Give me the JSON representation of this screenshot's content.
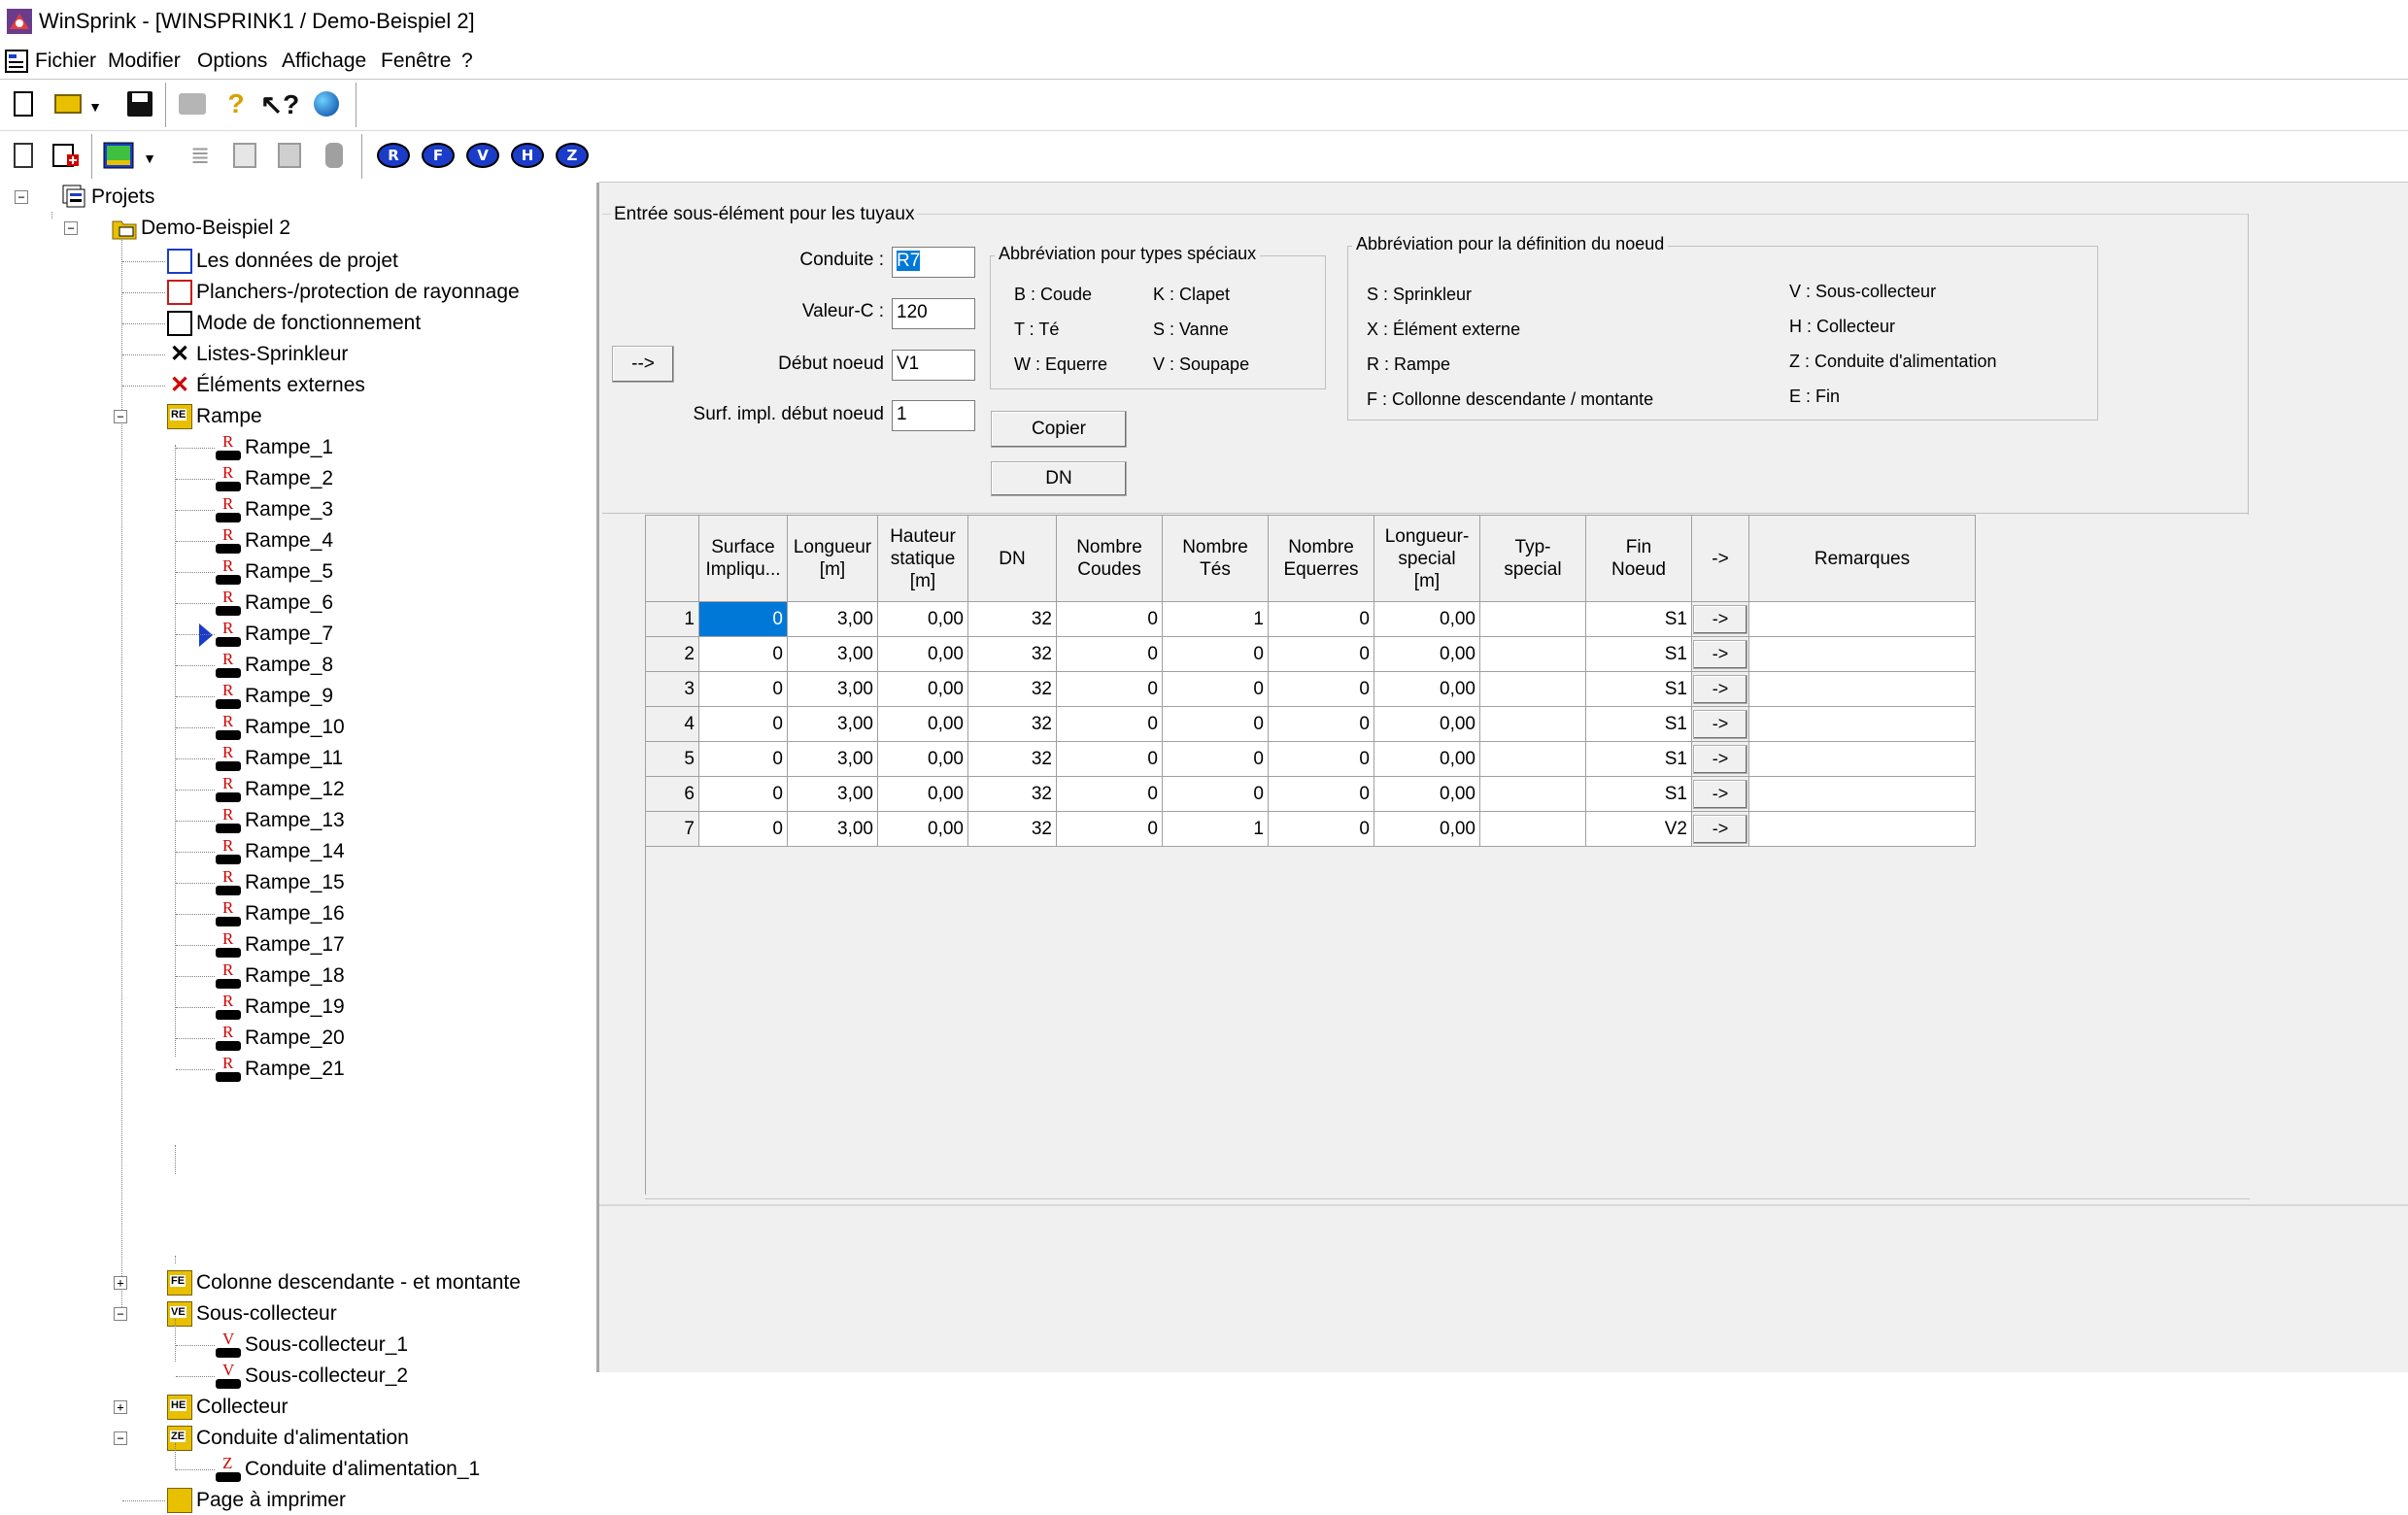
{
  "window": {
    "title": "WinSprink - [WINSPRINK1 / Demo-Beispiel 2]",
    "app_icon": "winsprink-app-icon"
  },
  "menu": {
    "items": [
      "Fichier",
      "Modifier",
      "Options",
      "Affichage",
      "Fenêtre",
      "?"
    ]
  },
  "toolbar1": {
    "icons": [
      "new-document-icon",
      "open-folder-icon",
      "dropdown-arrow-icon",
      "save-disk-icon",
      "print-icon",
      "help-icon",
      "context-help-icon",
      "web-globe-icon"
    ]
  },
  "toolbar2": {
    "icons": [
      "project-data-icon",
      "add-element-icon",
      "image-view-icon",
      "dropdown-arrow-icon",
      "list-icon",
      "window-icon",
      "picture-icon",
      "cylinder-icon"
    ],
    "letter_buttons": [
      "R",
      "F",
      "V",
      "H",
      "Z"
    ]
  },
  "tree": {
    "root": "Projets",
    "project": "Demo-Beispiel 2",
    "items": [
      "Les données de projet",
      "Planchers-/protection de rayonnage",
      "Mode de fonctionnement",
      "Listes-Sprinkleur",
      "Éléments externes"
    ],
    "rampe_folder": "Rampe",
    "rampe_items": [
      "Rampe_1",
      "Rampe_2",
      "Rampe_3",
      "Rampe_4",
      "Rampe_5",
      "Rampe_6",
      "Rampe_7",
      "Rampe_8",
      "Rampe_9",
      "Rampe_10",
      "Rampe_11",
      "Rampe_12",
      "Rampe_13",
      "Rampe_14",
      "Rampe_15",
      "Rampe_16",
      "Rampe_17",
      "Rampe_18",
      "Rampe_19",
      "Rampe_20",
      "Rampe_21"
    ],
    "rampe_letter": "R",
    "colonne_folder": "Colonne descendante - et montante",
    "sous_collecteur_folder": "Sous-collecteur",
    "sous_collecteur_items": [
      "Sous-collecteur_1",
      "Sous-collecteur_2"
    ],
    "sous_collecteur_letter": "V",
    "collecteur_folder": "Collecteur",
    "conduite_folder": "Conduite d'alimentation",
    "conduite_items": [
      "Conduite d'alimentation_1"
    ],
    "conduite_letter": "Z",
    "page_item": "Page à imprimer",
    "folder_tags": {
      "rampe": "RE",
      "colonne": "FE",
      "sous": "VE",
      "collecteur": "HE",
      "conduite": "ZE"
    },
    "selected_marker": "Rampe_7"
  },
  "form": {
    "section_title": "Entrée sous-élément pour les tuyaux",
    "conduite_label": "Conduite :",
    "conduite_value": "R7",
    "valeur_c_label": "Valeur-C :",
    "valeur_c_value": "120",
    "debut_label": "Début noeud",
    "debut_value": "V1",
    "surf_label": "Surf. impl. début noeud",
    "surf_value": "1",
    "arrow_button": "-->",
    "copier_button": "Copier",
    "dn_button": "DN"
  },
  "abbr_special": {
    "title": "Abbréviation pour types spéciaux",
    "items": [
      "B : Coude",
      "K : Clapet",
      "T : Té",
      "S : Vanne",
      "W : Equerre",
      "V : Soupape"
    ]
  },
  "abbr_node": {
    "title": "Abbréviation pour la définition du noeud",
    "left": [
      "S : Sprinkleur",
      "X : Élément externe",
      "R : Rampe",
      "F : Collonne descendante / montante"
    ],
    "right": [
      "V : Sous-collecteur",
      "H : Collecteur",
      "Z : Conduite d'alimentation",
      "E : Fin"
    ]
  },
  "grid": {
    "headers": [
      "Surface Impliqu...",
      "Longueur [m]",
      "Hauteur statique [m]",
      "DN",
      "Nombre Coudes",
      "Nombre Tés",
      "Nombre Equerres",
      "Longueur-special [m]",
      "Typ-special",
      "Fin Noeud",
      "->",
      "Remarques"
    ],
    "header_lines": [
      [
        "Surface",
        "Impliqu..."
      ],
      [
        "Longueur",
        "[m]"
      ],
      [
        "Hauteur",
        "statique",
        "[m]"
      ],
      [
        "DN"
      ],
      [
        "Nombre",
        "Coudes"
      ],
      [
        "Nombre",
        "Tés"
      ],
      [
        "Nombre",
        "Equerres"
      ],
      [
        "Longueur-",
        "special",
        "[m]"
      ],
      [
        "Typ-",
        "special"
      ],
      [
        "Fin",
        "Noeud"
      ],
      [
        "->"
      ],
      [
        "Remarques"
      ]
    ],
    "rows": [
      {
        "n": "1",
        "surface": "0",
        "longueur": "3,00",
        "hauteur": "0,00",
        "dn": "32",
        "coudes": "0",
        "tes": "1",
        "equerres": "0",
        "lspecial": "0,00",
        "typ": "",
        "fin": "S1",
        "arrow": "->",
        "remarques": ""
      },
      {
        "n": "2",
        "surface": "0",
        "longueur": "3,00",
        "hauteur": "0,00",
        "dn": "32",
        "coudes": "0",
        "tes": "0",
        "equerres": "0",
        "lspecial": "0,00",
        "typ": "",
        "fin": "S1",
        "arrow": "->",
        "remarques": ""
      },
      {
        "n": "3",
        "surface": "0",
        "longueur": "3,00",
        "hauteur": "0,00",
        "dn": "32",
        "coudes": "0",
        "tes": "0",
        "equerres": "0",
        "lspecial": "0,00",
        "typ": "",
        "fin": "S1",
        "arrow": "->",
        "remarques": ""
      },
      {
        "n": "4",
        "surface": "0",
        "longueur": "3,00",
        "hauteur": "0,00",
        "dn": "32",
        "coudes": "0",
        "tes": "0",
        "equerres": "0",
        "lspecial": "0,00",
        "typ": "",
        "fin": "S1",
        "arrow": "->",
        "remarques": ""
      },
      {
        "n": "5",
        "surface": "0",
        "longueur": "3,00",
        "hauteur": "0,00",
        "dn": "32",
        "coudes": "0",
        "tes": "0",
        "equerres": "0",
        "lspecial": "0,00",
        "typ": "",
        "fin": "S1",
        "arrow": "->",
        "remarques": ""
      },
      {
        "n": "6",
        "surface": "0",
        "longueur": "3,00",
        "hauteur": "0,00",
        "dn": "32",
        "coudes": "0",
        "tes": "0",
        "equerres": "0",
        "lspecial": "0,00",
        "typ": "",
        "fin": "S1",
        "arrow": "->",
        "remarques": ""
      },
      {
        "n": "7",
        "surface": "0",
        "longueur": "3,00",
        "hauteur": "0,00",
        "dn": "32",
        "coudes": "0",
        "tes": "1",
        "equerres": "0",
        "lspecial": "0,00",
        "typ": "",
        "fin": "V2",
        "arrow": "->",
        "remarques": ""
      }
    ]
  },
  "colors": {
    "selection": "#0078d7",
    "tree_marker": "#1a3cc8",
    "element_letter": "#d00000",
    "panel_bg": "#f0f0f0"
  }
}
